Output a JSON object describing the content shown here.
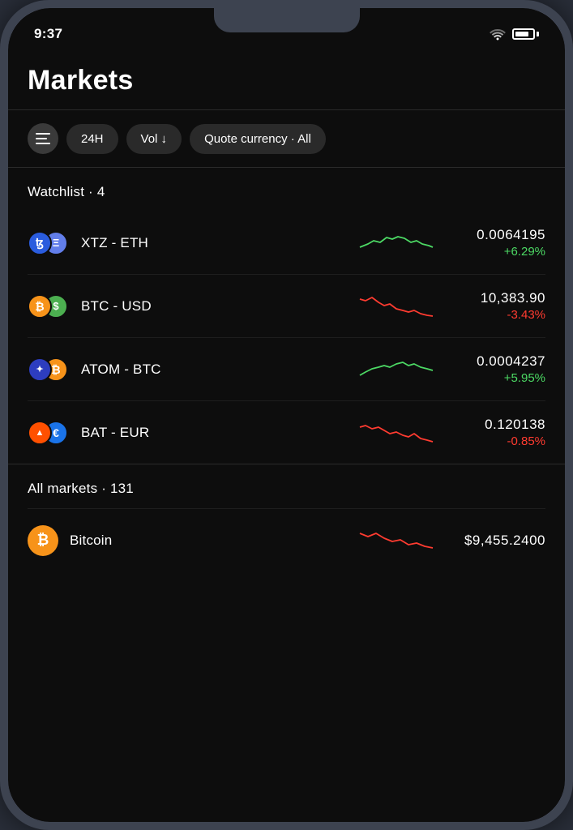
{
  "statusBar": {
    "time": "9:37"
  },
  "header": {
    "title": "Markets"
  },
  "filters": {
    "icon_label": "filter",
    "buttons": [
      {
        "label": "24H",
        "id": "24h"
      },
      {
        "label": "Vol ↓",
        "id": "vol"
      },
      {
        "label": "Quote currency · All",
        "id": "quote-currency"
      }
    ]
  },
  "watchlist": {
    "header": "Watchlist · 4",
    "items": [
      {
        "pair": "XTZ - ETH",
        "price": "0.0064195",
        "change": "+6.29%",
        "positive": true,
        "primary_color": "#2a5cde",
        "primary_text": "ꜩ",
        "secondary_color": "#627eea",
        "secondary_text": "Ξ",
        "chart_type": "up"
      },
      {
        "pair": "BTC - USD",
        "price": "10,383.90",
        "change": "-3.43%",
        "positive": false,
        "primary_color": "#f7931a",
        "primary_text": "₿",
        "secondary_color": "#4caf50",
        "secondary_text": "$",
        "chart_type": "down"
      },
      {
        "pair": "ATOM - BTC",
        "price": "0.0004237",
        "change": "+5.95%",
        "positive": true,
        "primary_color": "#2d3dbf",
        "primary_text": "✦",
        "secondary_color": "#f7931a",
        "secondary_text": "₿",
        "chart_type": "up"
      },
      {
        "pair": "BAT - EUR",
        "price": "0.120138",
        "change": "-0.85%",
        "positive": false,
        "primary_color": "#ff5000",
        "primary_text": "▲",
        "secondary_color": "#1a73e8",
        "secondary_text": "€",
        "chart_type": "down"
      }
    ]
  },
  "allMarkets": {
    "header": "All markets · 131",
    "items": [
      {
        "name": "Bitcoin",
        "price": "$9,455.2400",
        "color": "#f7931a",
        "text": "₿",
        "positive": false,
        "chart_type": "down"
      }
    ]
  }
}
